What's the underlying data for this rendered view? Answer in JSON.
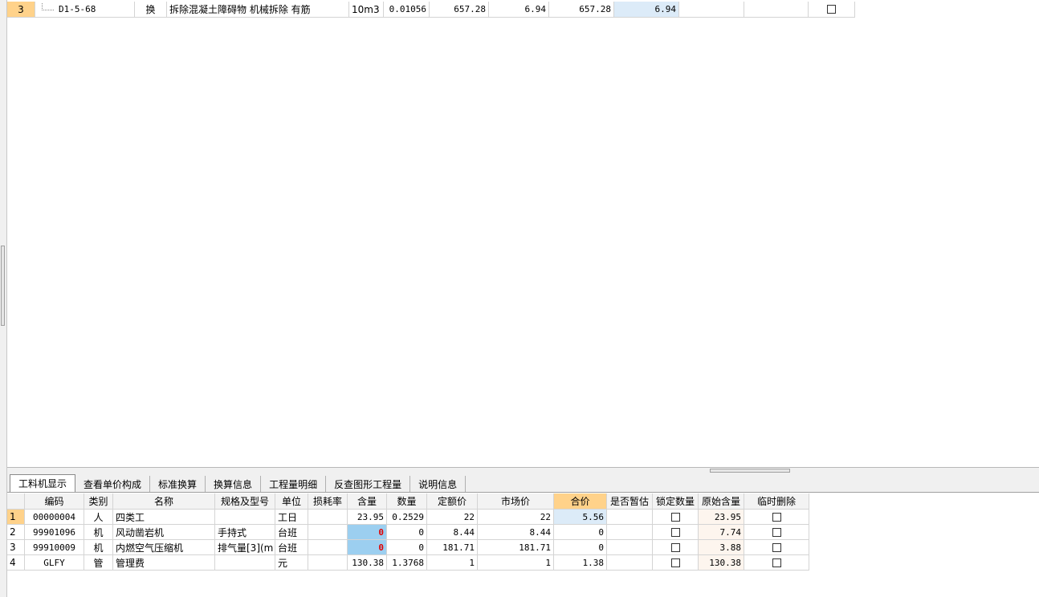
{
  "top_grid": {
    "rows": [
      {
        "no": "3",
        "code": "D1-5-68",
        "type": "换",
        "name": "拆除混凝土障碍物 机械拆除 有筋",
        "unit": "10m3",
        "qty": "0.01056",
        "v1": "657.28",
        "v2": "6.94",
        "v3": "657.28",
        "v4": "6.94",
        "v5": "",
        "v6": ""
      }
    ]
  },
  "tabs": [
    "工料机显示",
    "查看单价构成",
    "标准换算",
    "换算信息",
    "工程量明细",
    "反查图形工程量",
    "说明信息"
  ],
  "bottom_grid": {
    "headers": [
      "",
      "编码",
      "类别",
      "名称",
      "规格及型号",
      "单位",
      "损耗率",
      "含量",
      "数量",
      "定额价",
      "市场价",
      "合价",
      "是否暂估",
      "锁定数量",
      "原始含量",
      "临时删除"
    ],
    "rows": [
      {
        "no": "1",
        "code": "00000004",
        "cat": "人",
        "name": "四类工",
        "spec": "",
        "unit": "工日",
        "loss": "",
        "content": "23.95",
        "qty": "0.2529",
        "quota": "22",
        "market": "22",
        "total": "5.56",
        "est": "",
        "orig": "23.95"
      },
      {
        "no": "2",
        "code": "99901096",
        "cat": "机",
        "name": "风动凿岩机",
        "spec": "手持式",
        "unit": "台班",
        "loss": "",
        "content": "0",
        "qty": "0",
        "quota": "8.44",
        "market": "8.44",
        "total": "0",
        "est": "",
        "orig": "7.74"
      },
      {
        "no": "3",
        "code": "99910009",
        "cat": "机",
        "name": "内燃空气压缩机",
        "spec": "排气量[3](m",
        "unit": "台班",
        "loss": "",
        "content": "0",
        "qty": "0",
        "quota": "181.71",
        "market": "181.71",
        "total": "0",
        "est": "",
        "orig": "3.88"
      },
      {
        "no": "4",
        "code": "GLFY",
        "cat": "管",
        "name": "管理费",
        "spec": "",
        "unit": "元",
        "loss": "",
        "content": "130.38",
        "qty": "1.3768",
        "quota": "1",
        "market": "1",
        "total": "1.38",
        "est": "",
        "orig": "130.38"
      }
    ]
  }
}
